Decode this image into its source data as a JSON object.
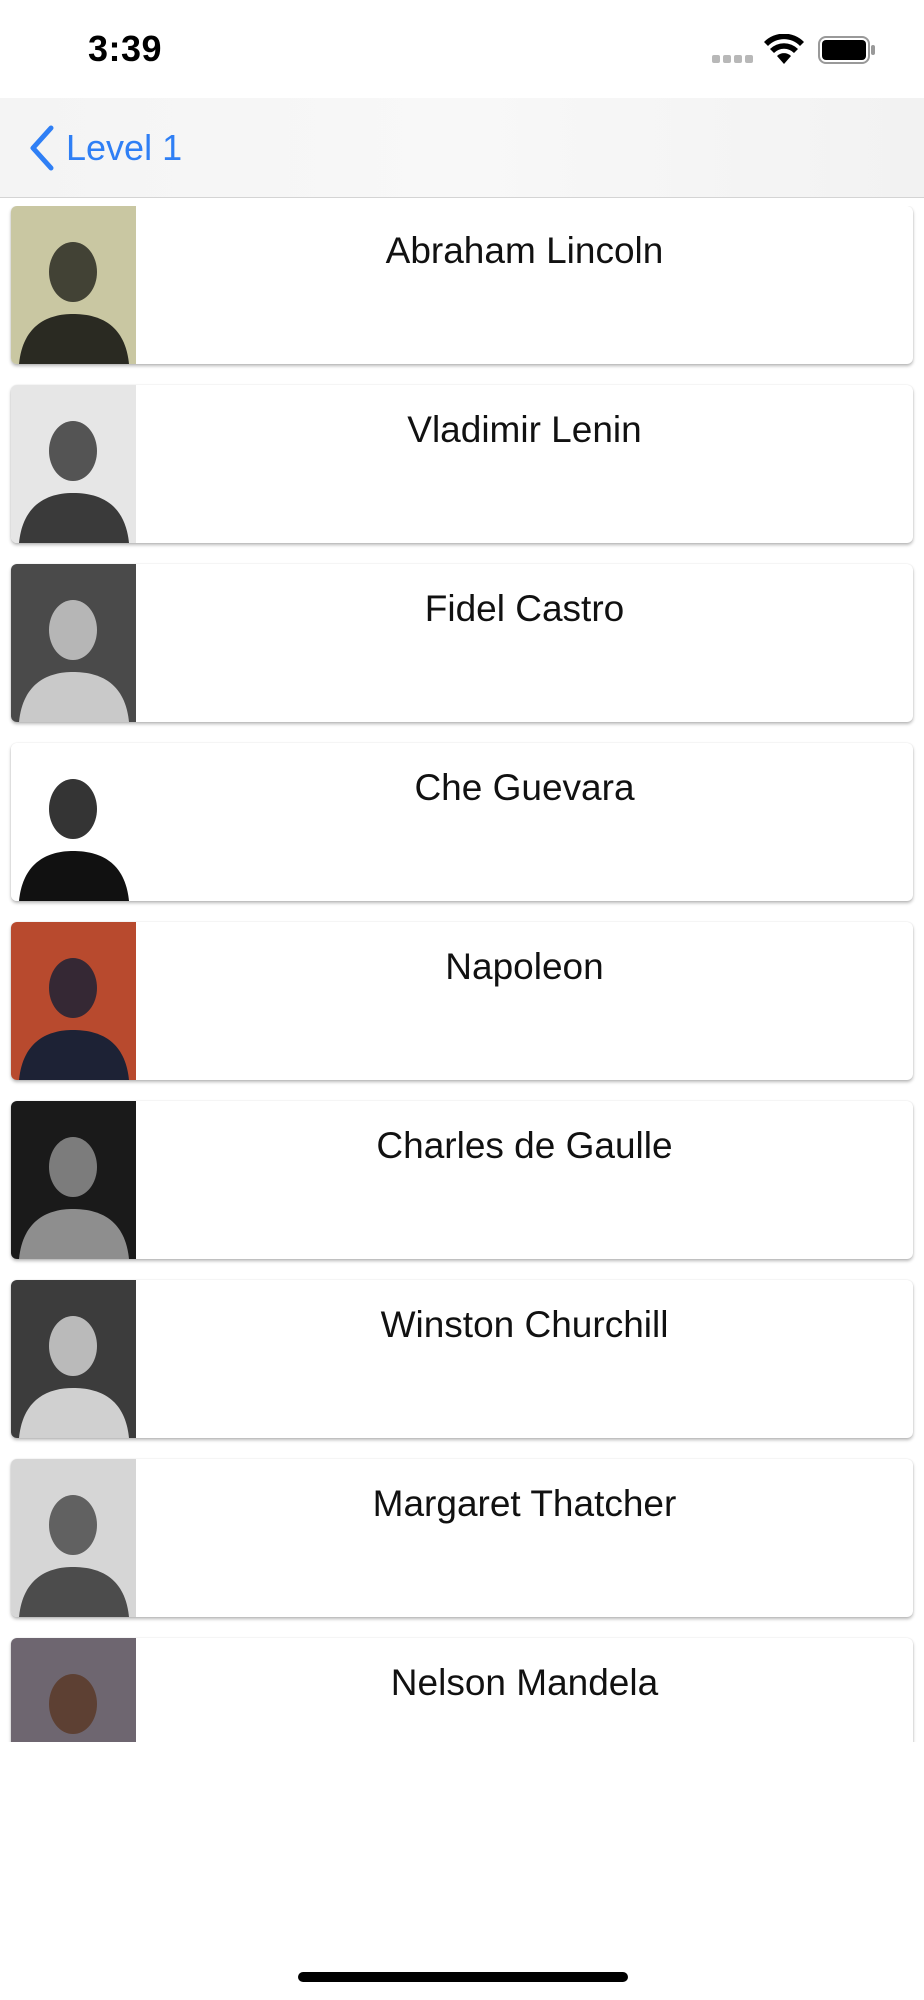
{
  "status_bar": {
    "time": "3:39"
  },
  "nav": {
    "back_label": "Level 1",
    "accent_color": "#2f7ff5"
  },
  "people": [
    {
      "name": "Abraham Lincoln",
      "bg": "#c9c7a2",
      "tone": "#2a2a22"
    },
    {
      "name": "Vladimir Lenin",
      "bg": "#e6e6e6",
      "tone": "#3a3a3a"
    },
    {
      "name": "Fidel Castro",
      "bg": "#4a4a4a",
      "tone": "#c9c9c9"
    },
    {
      "name": "Che Guevara",
      "bg": "#ffffff",
      "tone": "#111111"
    },
    {
      "name": "Napoleon",
      "bg": "#b84a2e",
      "tone": "#1d2235"
    },
    {
      "name": "Charles de Gaulle",
      "bg": "#1a1a1a",
      "tone": "#8e8e8e"
    },
    {
      "name": "Winston Churchill",
      "bg": "#3c3c3c",
      "tone": "#d0d0d0"
    },
    {
      "name": "Margaret Thatcher",
      "bg": "#d6d6d6",
      "tone": "#4c4c4c"
    },
    {
      "name": "Nelson Mandela",
      "bg": "#6e6670",
      "tone": "#5a3a28"
    }
  ]
}
